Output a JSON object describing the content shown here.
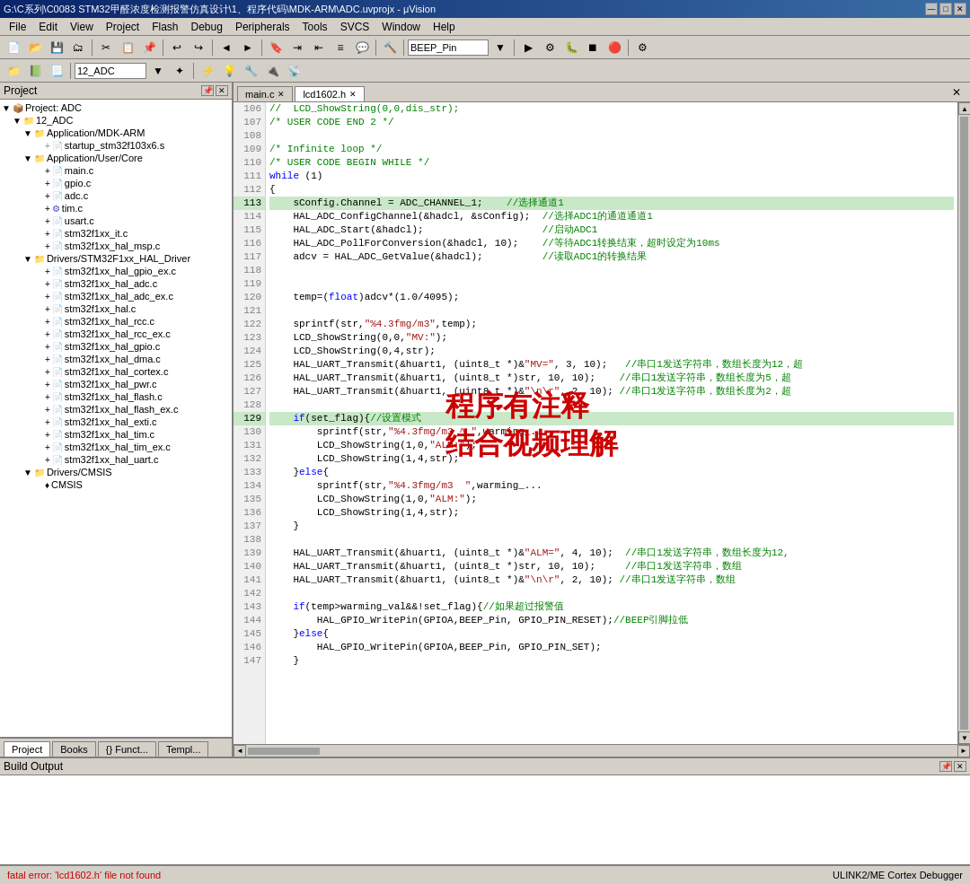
{
  "titlebar": {
    "title": "G:\\C系列\\C0083 STM32甲醛浓度检测报警仿真设计\\1、程序代码\\MDK-ARM\\ADC.uvprojx - μVision",
    "min_label": "—",
    "max_label": "□",
    "close_label": "✕"
  },
  "menubar": {
    "items": [
      "File",
      "Edit",
      "View",
      "Project",
      "Flash",
      "Debug",
      "Peripherals",
      "Tools",
      "SVCS",
      "Window",
      "Help"
    ]
  },
  "toolbar1": {
    "beep_pin_label": "BEEP_Pin"
  },
  "toolbar2": {
    "project_name": "12_ADC"
  },
  "left_panel": {
    "title": "Project",
    "tree": [
      {
        "level": 0,
        "type": "project",
        "label": "Project: ADC"
      },
      {
        "level": 1,
        "type": "folder",
        "label": "12_ADC"
      },
      {
        "level": 2,
        "type": "folder",
        "label": "Application/MDK-ARM"
      },
      {
        "level": 3,
        "type": "file",
        "label": "startup_stm32f103x6.s"
      },
      {
        "level": 2,
        "type": "folder",
        "label": "Application/User/Core"
      },
      {
        "level": 3,
        "type": "file",
        "label": "main.c"
      },
      {
        "level": 3,
        "type": "file",
        "label": "gpio.c"
      },
      {
        "level": 3,
        "type": "file",
        "label": "adc.c"
      },
      {
        "level": 3,
        "type": "file",
        "label": "tim.c"
      },
      {
        "level": 3,
        "type": "file",
        "label": "usart.c"
      },
      {
        "level": 3,
        "type": "file",
        "label": "stm32f1xx_it.c"
      },
      {
        "level": 3,
        "type": "file",
        "label": "stm32f1xx_hal_msp.c"
      },
      {
        "level": 2,
        "type": "folder",
        "label": "Drivers/STM32F1xx_HAL_Driver"
      },
      {
        "level": 3,
        "type": "file",
        "label": "stm32f1xx_hal_gpio_ex.c"
      },
      {
        "level": 3,
        "type": "file",
        "label": "stm32f1xx_hal_adc.c"
      },
      {
        "level": 3,
        "type": "file",
        "label": "stm32f1xx_hal_adc_ex.c"
      },
      {
        "level": 3,
        "type": "file",
        "label": "stm32f1xx_hal.c"
      },
      {
        "level": 3,
        "type": "file",
        "label": "stm32f1xx_hal_rcc.c"
      },
      {
        "level": 3,
        "type": "file",
        "label": "stm32f1xx_hal_rcc_ex.c"
      },
      {
        "level": 3,
        "type": "file",
        "label": "stm32f1xx_hal_gpio.c"
      },
      {
        "level": 3,
        "type": "file",
        "label": "stm32f1xx_hal_dma.c"
      },
      {
        "level": 3,
        "type": "file",
        "label": "stm32f1xx_hal_cortex.c"
      },
      {
        "level": 3,
        "type": "file",
        "label": "stm32f1xx_hal_pwr.c"
      },
      {
        "level": 3,
        "type": "file",
        "label": "stm32f1xx_hal_flash.c"
      },
      {
        "level": 3,
        "type": "file",
        "label": "stm32f1xx_hal_flash_ex.c"
      },
      {
        "level": 3,
        "type": "file",
        "label": "stm32f1xx_hal_exti.c"
      },
      {
        "level": 3,
        "type": "file",
        "label": "stm32f1xx_hal_tim.c"
      },
      {
        "level": 3,
        "type": "file",
        "label": "stm32f1xx_hal_tim_ex.c"
      },
      {
        "level": 3,
        "type": "file",
        "label": "stm32f1xx_hal_uart.c"
      },
      {
        "level": 2,
        "type": "folder",
        "label": "Drivers/CMSIS"
      },
      {
        "level": 3,
        "type": "file",
        "label": "CMSIS"
      }
    ],
    "bottom_tabs": [
      "Project",
      "Books",
      "{} Funct...",
      "Templ..."
    ]
  },
  "editor": {
    "tabs": [
      {
        "label": "main.c",
        "active": false
      },
      {
        "label": "lcd1602.h",
        "active": true
      }
    ],
    "lines": [
      {
        "num": 106,
        "code": "//  LCD_ShowString(0,0,dis_str);",
        "type": "comment"
      },
      {
        "num": 107,
        "code": "/* USER CODE END 2 */",
        "type": "comment"
      },
      {
        "num": 108,
        "code": ""
      },
      {
        "num": 109,
        "code": "/* Infinite loop */",
        "type": "comment"
      },
      {
        "num": 110,
        "code": "/* USER CODE BEGIN WHILE */",
        "type": "comment"
      },
      {
        "num": 111,
        "code": "while (1)",
        "type": "keyword"
      },
      {
        "num": 112,
        "code": "{"
      },
      {
        "num": 113,
        "code": "    sConfig.Channel = ADC_CHANNEL_1;    //选择通道1",
        "type": "mixed"
      },
      {
        "num": 114,
        "code": "    HAL_ADC_ConfigChannel(&hadcl, &sConfig);  //选择ADC1的通道通道1",
        "type": "mixed"
      },
      {
        "num": 115,
        "code": "    HAL_ADC_Start(&hadcl);                    //启动ADC1",
        "type": "mixed"
      },
      {
        "num": 116,
        "code": "    HAL_ADC_PollForConversion(&hadcl, 10);    //等待ADC1转换结束，超时设定为10ms",
        "type": "mixed"
      },
      {
        "num": 117,
        "code": "    adcv = HAL_ADC_GetValue(&hadcl);          //读取ADC1的转换结果",
        "type": "mixed"
      },
      {
        "num": 118,
        "code": ""
      },
      {
        "num": 119,
        "code": ""
      },
      {
        "num": 120,
        "code": "    temp=(float)adcv*(1.0/4095);"
      },
      {
        "num": 121,
        "code": ""
      },
      {
        "num": 122,
        "code": "    sprintf(str,\"%4.3fmg/m3\",temp);"
      },
      {
        "num": 123,
        "code": "    LCD_ShowString(0,0,\"MV:\");"
      },
      {
        "num": 124,
        "code": "    LCD_ShowString(0,4,str);"
      },
      {
        "num": 125,
        "code": "    HAL_UART_Transmit(&huart1, (uint8_t *)&\"MV=\", 3, 10);   //串口1发送字符串，数组长度为12，超"
      },
      {
        "num": 126,
        "code": "    HAL_UART_Transmit(&huart1, (uint8_t *)str, 10, 10);    //串口1发送字符串，数组长度为5，超"
      },
      {
        "num": 127,
        "code": "    HAL_UART_Transmit(&huart1, (uint8_t *)&\"\\n\\r\", 2, 10); //串口1发送字符串，数组长度为2，超"
      },
      {
        "num": 128,
        "code": ""
      },
      {
        "num": 129,
        "code": "    if(set_flag){//设置模式",
        "type": "mixed"
      },
      {
        "num": 130,
        "code": "        sprintf(str,\"%4.3fmg/m3 ^ \",warming_...",
        "type": "mixed"
      },
      {
        "num": 131,
        "code": "        LCD_ShowString(1,0,\"ALM:\");"
      },
      {
        "num": 132,
        "code": "        LCD_ShowString(1,4,str);"
      },
      {
        "num": 133,
        "code": "    }else{"
      },
      {
        "num": 134,
        "code": "        sprintf(str,\"%4.3fmg/m3  \",warming_...",
        "type": "mixed"
      },
      {
        "num": 135,
        "code": "        LCD_ShowString(1,0,\"ALM:\");"
      },
      {
        "num": 136,
        "code": "        LCD_ShowString(1,4,str);"
      },
      {
        "num": 137,
        "code": "    }"
      },
      {
        "num": 138,
        "code": ""
      },
      {
        "num": 139,
        "code": "    HAL_UART_Transmit(&huart1, (uint8_t *)&\"ALM=\", 4, 10);  //串口1发送字符串，数组长度为12,"
      },
      {
        "num": 140,
        "code": "    HAL_UART_Transmit(&huart1, (uint8_t *)str, 10, 10);     //串口1发送字符串，数组"
      },
      {
        "num": 141,
        "code": "    HAL_UART_Transmit(&huart1, (uint8_t *)&\"\\n\\r\", 2, 10); //串口1发送字符串，数组"
      },
      {
        "num": 142,
        "code": ""
      },
      {
        "num": 143,
        "code": "    if(temp>warming_val&&!set_flag){//如果超过报警值",
        "type": "mixed"
      },
      {
        "num": 144,
        "code": "        HAL_GPIO_WritePin(GPIOA,BEEP_Pin, GPIO_PIN_RESET);//BEEP引脚拉低"
      },
      {
        "num": 145,
        "code": "    }else{"
      },
      {
        "num": 146,
        "code": "        HAL_GPIO_WritePin(GPIOA,BEEP_Pin, GPIO_PIN_SET);"
      },
      {
        "num": 147,
        "code": "    }"
      }
    ],
    "annotation": {
      "line1": "程序有注释",
      "line2": "结合视频理解"
    }
  },
  "build_output": {
    "title": "Build Output",
    "content": ""
  },
  "status_bar": {
    "error_msg": "fatal error: 'lcd1602.h' file not found",
    "debug_info": "ULINK2/ME Cortex Debugger"
  },
  "icons": {
    "folder": "📁",
    "file": "📄",
    "project": "📦",
    "minus": "─",
    "close": "✕",
    "restore": "□",
    "triangle_right": "▶",
    "triangle_down": "▼",
    "arrow_up": "▲",
    "arrow_down": "▼",
    "arrow_left": "◄",
    "arrow_right": "►"
  }
}
